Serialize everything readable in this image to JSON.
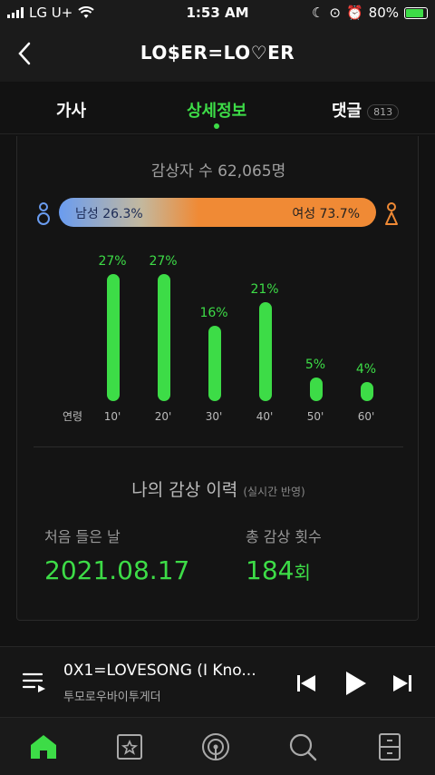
{
  "status_bar": {
    "carrier": "LG U+",
    "time": "1:53 AM",
    "battery": "80%"
  },
  "header": {
    "title": "LO$ER=LO♡ER"
  },
  "tabs": [
    {
      "label": "가사"
    },
    {
      "label": "상세정보"
    },
    {
      "label": "댓글",
      "count": "813"
    }
  ],
  "stats": {
    "listeners": "감상자 수 62,065명",
    "male": "남성 26.3%",
    "female": "여성 73.7%",
    "male_fraction": 0.263,
    "age_label": "연령"
  },
  "chart_data": {
    "type": "bar",
    "categories": [
      "10'",
      "20'",
      "30'",
      "40'",
      "50'",
      "60'"
    ],
    "values": [
      27,
      27,
      16,
      21,
      5,
      4
    ],
    "value_labels": [
      "27%",
      "27%",
      "16%",
      "21%",
      "5%",
      "4%"
    ],
    "xlabel": "연령",
    "ylim": [
      0,
      27
    ]
  },
  "history": {
    "title": "나의 감상 이력",
    "subtitle": "(실시간 반영)",
    "first_label": "처음 들은 날",
    "first_value": "2021.08.17",
    "count_label": "총 감상 횟수",
    "count_value": "184",
    "count_unit": "회"
  },
  "player": {
    "song": "0X1=LOVESONG (I Kno...",
    "artist": "투모로우바이투게더"
  },
  "colors": {
    "accent": "#3ddc47",
    "male": "#6a9cf0",
    "female": "#f08a35"
  }
}
